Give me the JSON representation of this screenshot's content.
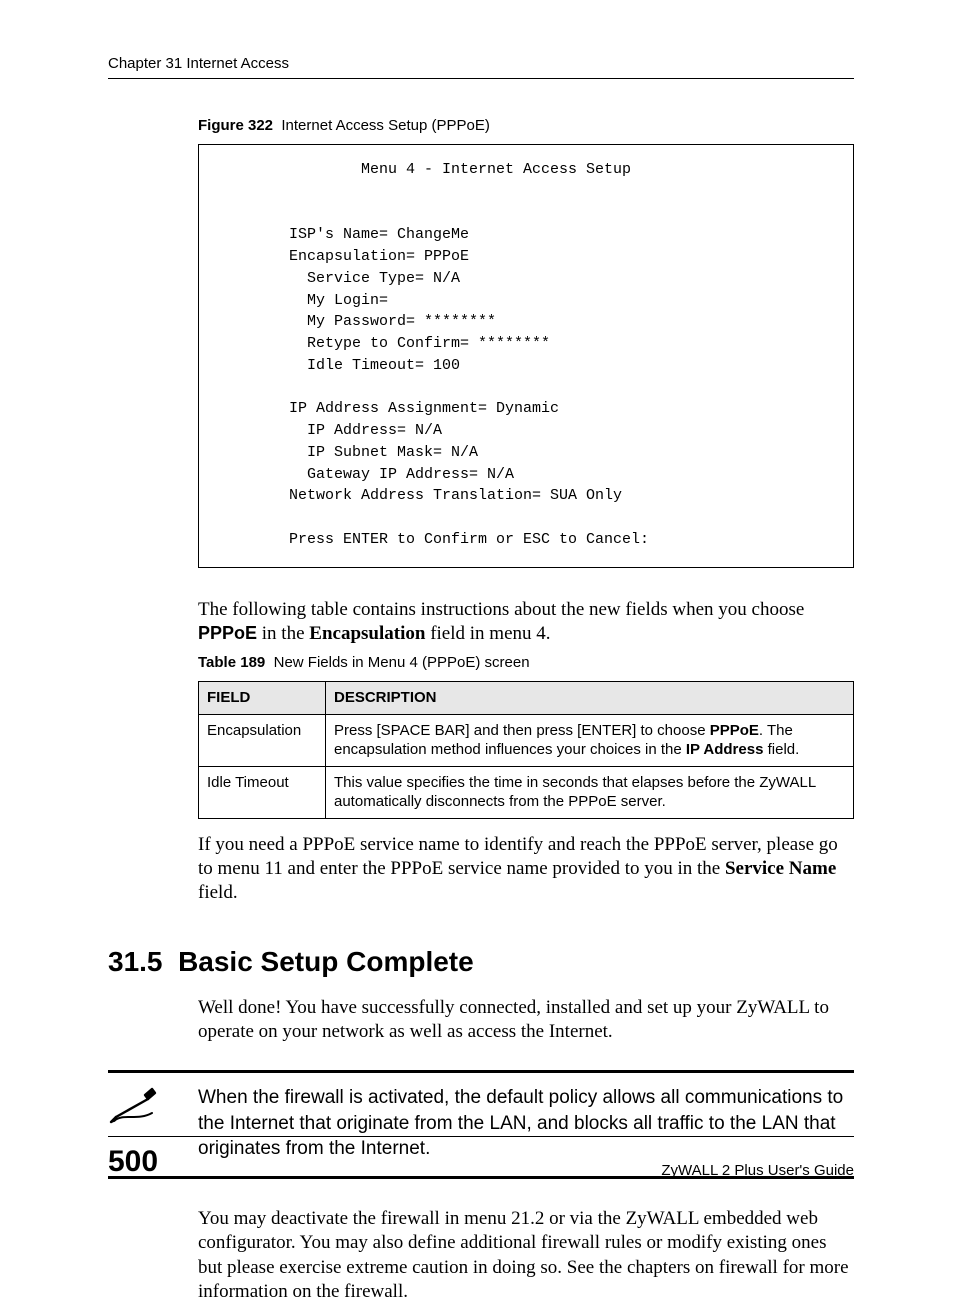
{
  "header": {
    "chapter": "Chapter 31 Internet Access"
  },
  "figure": {
    "label": "Figure 322",
    "title": "Internet Access Setup (PPPoE)",
    "terminal": {
      "menu_title": "Menu 4 - Internet Access Setup",
      "l1": "ISP's Name= ChangeMe",
      "l2": "Encapsulation= PPPoE",
      "l3": "  Service Type= N/A",
      "l4": "  My Login=",
      "l5": "  My Password= ********",
      "l6": "  Retype to Confirm= ********",
      "l7": "  Idle Timeout= 100",
      "l8": "IP Address Assignment= Dynamic",
      "l9": "  IP Address= N/A",
      "l10": "  IP Subnet Mask= N/A",
      "l11": "  Gateway IP Address= N/A",
      "l12": "Network Address Translation= SUA Only",
      "l13": "Press ENTER to Confirm or ESC to Cancel:"
    }
  },
  "intro_para": {
    "t1": "The following table contains instructions about the new fields when you choose ",
    "b1": "PPPoE",
    "t2": " in the ",
    "b2": "Encapsulation",
    "t3": " field in menu 4."
  },
  "table": {
    "label": "Table 189",
    "title": "New Fields in Menu 4 (PPPoE) screen",
    "head_field": "Field",
    "head_desc": "Description",
    "rows": [
      {
        "field": "Encapsulation",
        "d1": "Press [SPACE BAR] and then press [ENTER] to choose ",
        "b1": "PPPoE",
        "d2": ". The encapsulation method influences your choices in the ",
        "b2": "IP Address",
        "d3": " field."
      },
      {
        "field": "Idle Timeout",
        "d1": "This value specifies the time in seconds that elapses before the ZyWALL automatically disconnects from the PPPoE server.",
        "b1": "",
        "d2": "",
        "b2": "",
        "d3": ""
      }
    ]
  },
  "after_table": {
    "t1": "If you need a PPPoE service name to identify and reach the PPPoE server, please go to menu 11 and enter the PPPoE service name provided to you in the ",
    "b1": "Service Name",
    "t2": " field."
  },
  "section": {
    "number": "31.5",
    "title": "Basic Setup Complete",
    "p1": "Well done! You have successfully connected, installed and set up your ZyWALL to operate on your network as well as access the Internet."
  },
  "note": {
    "text": "When the firewall is activated, the default policy allows all communications to the Internet that originate from the LAN, and blocks all traffic to the LAN that originates from the Internet."
  },
  "closing": {
    "text": "You may deactivate the firewall in menu 21.2 or via the ZyWALL embedded web configurator. You may also define additional firewall rules or modify existing ones but please exercise extreme caution in doing so. See the chapters on firewall for more information on the firewall."
  },
  "footer": {
    "page": "500",
    "guide": "ZyWALL 2 Plus User's Guide"
  }
}
